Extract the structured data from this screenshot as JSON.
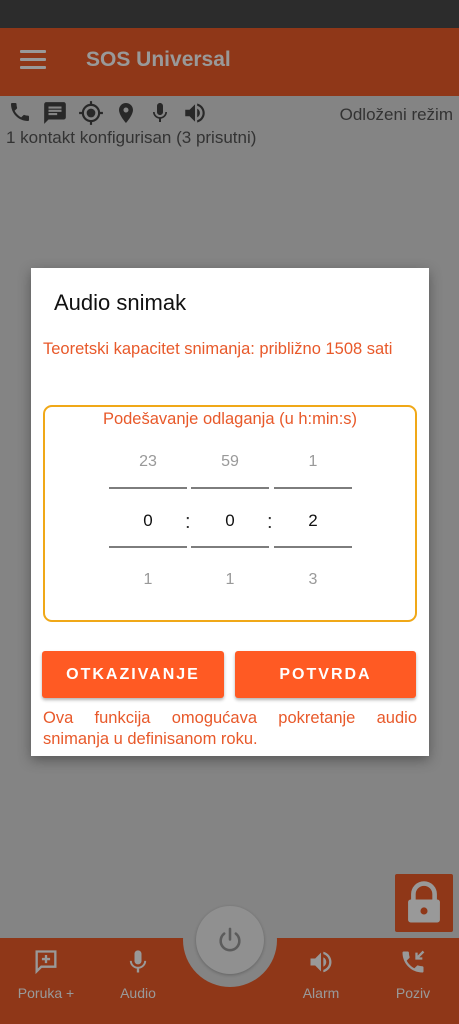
{
  "app": {
    "title": "SOS Universal",
    "mode_text": "Odloženi režim",
    "contacts_text": "1 kontakt konfigurisan (3 prisutni)",
    "status_icons": [
      "phone-icon",
      "message-icon",
      "gps-target-icon",
      "location-pin-icon",
      "microphone-icon",
      "speaker-icon"
    ]
  },
  "dialog": {
    "title": "Audio snimak",
    "capacity": "Teoretski kapacitet snimanja: približno 1508 sati",
    "picker_label": "Podešavanje odlaganja (u h:min:s)",
    "hours": {
      "above": "23",
      "value": "0",
      "below": "1"
    },
    "minutes": {
      "above": "59",
      "value": "0",
      "below": "1"
    },
    "seconds": {
      "above": "1",
      "value": "2",
      "below": "3"
    },
    "separator": ":",
    "cancel_label": "OTKAZIVANJE",
    "confirm_label": "POTVRDA",
    "description": "Ova funkcija omogućava pokretanje audio snimanja u definisanom roku."
  },
  "bottom_nav": {
    "message_label": "Poruka +",
    "audio_label": "Audio",
    "alarm_label": "Alarm",
    "call_label": "Poziv"
  },
  "colors": {
    "accent": "#ee5c28",
    "button": "#ff5a23",
    "picker_border": "#f0a818",
    "text_accent": "#e8592a"
  }
}
